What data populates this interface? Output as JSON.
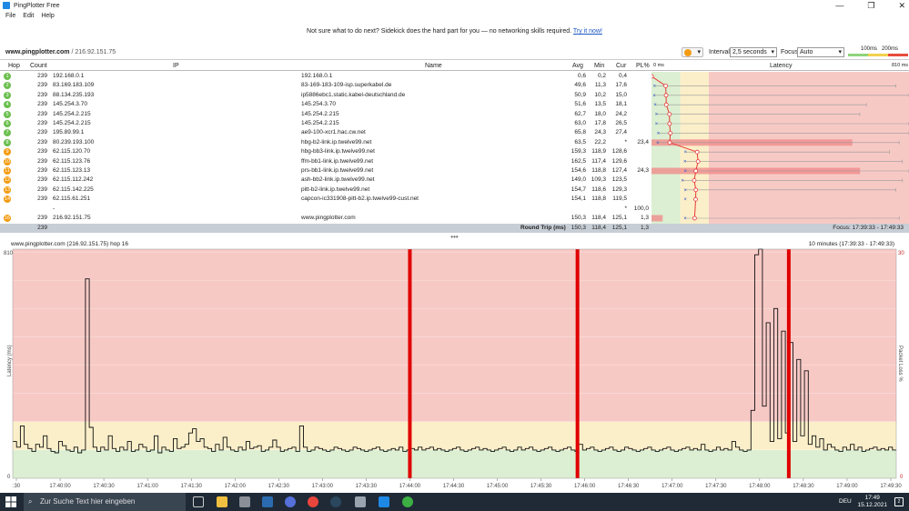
{
  "window": {
    "title": "PingPlotter Free",
    "minimize": "—",
    "maximize": "❐",
    "close": "✕"
  },
  "menu": [
    "File",
    "Edit",
    "Help"
  ],
  "banner": {
    "text": "Not sure what to do next? Sidekick does the hard part for you — no networking skills required.",
    "link": "Try it now!"
  },
  "target": {
    "host": "www.pingplotter.com",
    "ip": "/ 216.92.151.75",
    "interval_label": "Interval",
    "interval_value": "2,5 seconds",
    "focus_label": "Focus",
    "focus_value": "Auto",
    "legend_100": "100ms",
    "legend_200": "200ms",
    "colors": {
      "green": "#8fd47b",
      "yellow": "#f2d14e",
      "red": "#e74c3c"
    }
  },
  "table": {
    "headers": {
      "hop": "Hop",
      "count": "Count",
      "ip": "IP",
      "name": "Name",
      "avg": "Avg",
      "min": "Min",
      "cur": "Cur",
      "pl": "PL%",
      "lat0": "0 ms",
      "latency": "Latency",
      "lat810": "810 ms"
    },
    "rows": [
      {
        "hop": "1",
        "count": "239",
        "ip": "192.168.0.1",
        "name": "192.168.0.1",
        "avg": "0,6",
        "min": "0,2",
        "cur": "0,4",
        "pl": "",
        "color": "#6bbf4e",
        "dot": 0.6,
        "whisker": 0
      },
      {
        "hop": "2",
        "count": "239",
        "ip": "83.169.183.109",
        "name": "83-169-183-109-isp.superkabel.de",
        "avg": "49,6",
        "min": "11,3",
        "cur": "17,6",
        "pl": "",
        "color": "#6bbf4e",
        "dot": 49.6,
        "whisker": 770
      },
      {
        "hop": "3",
        "count": "239",
        "ip": "88.134.235.193",
        "name": "ip5886ebc1.static.kabel-deutschland.de",
        "avg": "50,9",
        "min": "10,2",
        "cur": "15,0",
        "pl": "",
        "color": "#6bbf4e",
        "dot": 50.9,
        "whisker": 810
      },
      {
        "hop": "4",
        "count": "239",
        "ip": "145.254.3.70",
        "name": "145.254.3.70",
        "avg": "51,6",
        "min": "13,5",
        "cur": "18,1",
        "pl": "",
        "color": "#6bbf4e",
        "dot": 51.6,
        "whisker": 680
      },
      {
        "hop": "5",
        "count": "239",
        "ip": "145.254.2.215",
        "name": "145.254.2.215",
        "avg": "62,7",
        "min": "18,0",
        "cur": "24,2",
        "pl": "",
        "color": "#6bbf4e",
        "dot": 62.7,
        "whisker": 660
      },
      {
        "hop": "6",
        "count": "239",
        "ip": "145.254.2.215",
        "name": "145.254.2.215",
        "avg": "63,0",
        "min": "17,8",
        "cur": "26,5",
        "pl": "",
        "color": "#6bbf4e",
        "dot": 63.0,
        "whisker": 810
      },
      {
        "hop": "7",
        "count": "239",
        "ip": "195.89.99.1",
        "name": "ae9-100-xcr1.hac.cw.net",
        "avg": "65,8",
        "min": "24,3",
        "cur": "27,4",
        "pl": "",
        "color": "#6bbf4e",
        "dot": 65.8,
        "whisker": 810
      },
      {
        "hop": "8",
        "count": "239",
        "ip": "80.239.193.100",
        "name": "hbg-b2-link.ip.twelve99.net",
        "avg": "63,5",
        "min": "22,2",
        "cur": "*",
        "pl": "23,4",
        "color": "#6bbf4e",
        "dot": 63.5,
        "whisker": 780,
        "loss": 23.4
      },
      {
        "hop": "9",
        "count": "239",
        "ip": "62.115.120.70",
        "name": "hbg-bb3-link.ip.twelve99.net",
        "avg": "159,3",
        "min": "118,9",
        "cur": "128,6",
        "pl": "",
        "color": "#f39c12",
        "dot": 159.3,
        "whisker": 750
      },
      {
        "hop": "10",
        "count": "239",
        "ip": "62.115.123.76",
        "name": "ffm-bb1-link.ip.twelve99.net",
        "avg": "162,5",
        "min": "117,4",
        "cur": "129,6",
        "pl": "",
        "color": "#f39c12",
        "dot": 162.5,
        "whisker": 790
      },
      {
        "hop": "11",
        "count": "239",
        "ip": "62.115.123.13",
        "name": "prs-bb1-link.ip.twelve99.net",
        "avg": "154,6",
        "min": "118,8",
        "cur": "127,4",
        "pl": "24,3",
        "color": "#f39c12",
        "dot": 154.6,
        "whisker": 810,
        "loss": 24.3
      },
      {
        "hop": "12",
        "count": "239",
        "ip": "62.115.112.242",
        "name": "ash-bb2-link.ip.twelve99.net",
        "avg": "149,0",
        "min": "109,3",
        "cur": "123,5",
        "pl": "",
        "color": "#f39c12",
        "dot": 149.0,
        "whisker": 790
      },
      {
        "hop": "13",
        "count": "239",
        "ip": "62.115.142.225",
        "name": "pitt-b2-link.ip.twelve99.net",
        "avg": "154,7",
        "min": "118,6",
        "cur": "129,3",
        "pl": "",
        "color": "#f39c12",
        "dot": 154.7,
        "whisker": 770
      },
      {
        "hop": "14",
        "count": "239",
        "ip": "62.115.61.251",
        "name": "capcon-ic331908-pitt-b2.ip.twelve99-cust.net",
        "avg": "154,1",
        "min": "118,8",
        "cur": "119,5",
        "pl": "",
        "color": "#f39c12",
        "dot": 154.1,
        "whisker": 0
      },
      {
        "hop": "",
        "count": "",
        "ip": "-",
        "name": "",
        "avg": "",
        "min": "",
        "cur": "*",
        "pl": "100,0",
        "color": "",
        "dot": null,
        "whisker": 0
      },
      {
        "hop": "16",
        "count": "239",
        "ip": "216.92.151.75",
        "name": "www.pingplotter.com",
        "avg": "150,3",
        "min": "118,4",
        "cur": "125,1",
        "pl": "1,3",
        "color": "#f39c12",
        "dot": 150.3,
        "whisker": 780,
        "loss": 1.3
      }
    ],
    "roundtrip": {
      "count": "239",
      "label": "Round Trip (ms)",
      "avg": "150,3",
      "min": "118,4",
      "cur": "125,1",
      "pl": "1,3",
      "focus": "Focus: 17:39:33 - 17:49:33"
    }
  },
  "graph_header": {
    "left": "www.pingplotter.com (216.92.151.75) hop 16",
    "right": "10 minutes (17:39:33 - 17:49:33)"
  },
  "chart_data": {
    "type": "line",
    "title": "www.pingplotter.com (216.92.151.75) hop 16",
    "ylabel": "Latency (ms)",
    "ylabel_right": "Packet Loss %",
    "ylim": [
      0,
      810
    ],
    "y_ticks": [
      "810",
      "0"
    ],
    "y_right_ticks": [
      "30",
      "0"
    ],
    "x_ticks": [
      ":30",
      "17:40:00",
      "17:40:30",
      "17:41:00",
      "17:41:30",
      "17:42:00",
      "17:42:30",
      "17:43:00",
      "17:43:30",
      "17:44:00",
      "17:44:30",
      "17:45:00",
      "17:45:30",
      "17:46:00",
      "17:46:30",
      "17:47:00",
      "17:47:30",
      "17:48:00",
      "17:48:30",
      "17:49:00",
      "17:49:30"
    ],
    "zones": {
      "green_max": 100,
      "yellow_max": 200,
      "colors": [
        "#dcefd2",
        "#fbefc9",
        "#f7c9c5"
      ]
    },
    "packet_loss_events": [
      "17:44:00",
      "17:45:55",
      "17:48:20"
    ],
    "series": [
      {
        "values": [
          130,
          110,
          185,
          120,
          105,
          95,
          120,
          110,
          150,
          105,
          95,
          90,
          130,
          115,
          100,
          95,
          110,
          90,
          100,
          705,
          180,
          110,
          95,
          110,
          100,
          150,
          105,
          95,
          110,
          100,
          130,
          95,
          100,
          120,
          110,
          95,
          100,
          150,
          90,
          110,
          100,
          95,
          140,
          105,
          110,
          120,
          160,
          175,
          130,
          140,
          110,
          105,
          95,
          120,
          100,
          145,
          110,
          100,
          95,
          110,
          100,
          130,
          105,
          110,
          115,
          95,
          100,
          110,
          135,
          110,
          95,
          100,
          105,
          110,
          95,
          185,
          110,
          95,
          100,
          110,
          105,
          100,
          95,
          100,
          110,
          105,
          100,
          95,
          100,
          110,
          105,
          100,
          95,
          100,
          105,
          110,
          100,
          95,
          100,
          105,
          100,
          110,
          95,
          100,
          105,
          100,
          110,
          100,
          105,
          110,
          100,
          105,
          100,
          95,
          100,
          105,
          110,
          100,
          95,
          100,
          105,
          110,
          100,
          105,
          100,
          95,
          100,
          105,
          110,
          100,
          95,
          100,
          110,
          100,
          105,
          110,
          100,
          95,
          100,
          105,
          110,
          100,
          95,
          100,
          105,
          110,
          100,
          95,
          120,
          100,
          105,
          110,
          100,
          95,
          100,
          105,
          110,
          100,
          95,
          100,
          110,
          105,
          100,
          95,
          100,
          105,
          110,
          100,
          95,
          100,
          105,
          110,
          100,
          95,
          100,
          105,
          110,
          100,
          105,
          100,
          120,
          100,
          95,
          100,
          110,
          100,
          105,
          100,
          130,
          110,
          100,
          95,
          100,
          240,
          790,
          820,
          255,
          550,
          130,
          600,
          140,
          520,
          160,
          480,
          130,
          420,
          150,
          380,
          120,
          150,
          110,
          140,
          100,
          120,
          110,
          100,
          95,
          110,
          100,
          120,
          100,
          110,
          95,
          100,
          105,
          110,
          100,
          105,
          100,
          110,
          100
        ]
      }
    ]
  },
  "taskbar": {
    "search_placeholder": "Zur Suche Text hier eingeben",
    "lang": "DEU",
    "time": "17:49",
    "date": "15.12.2021",
    "notifications": "2"
  }
}
